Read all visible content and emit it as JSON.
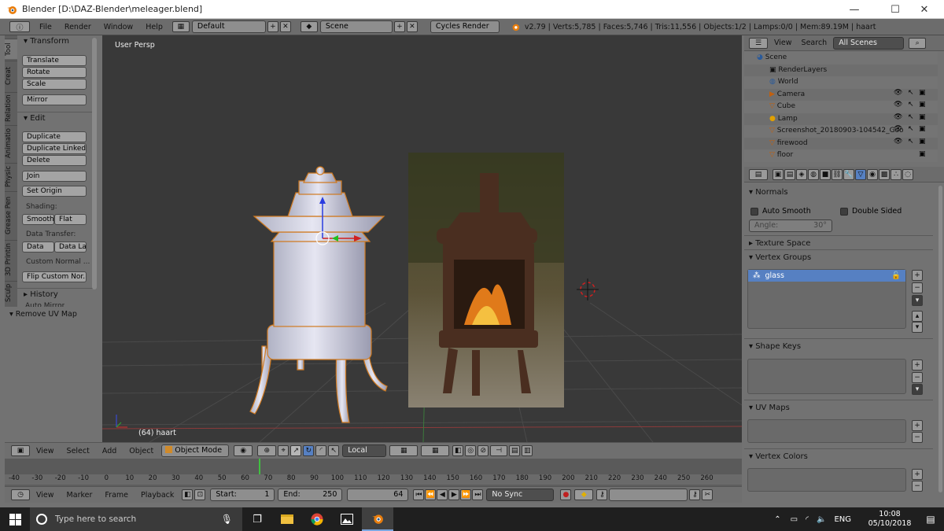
{
  "window": {
    "title": "Blender [D:\\DAZ-Blender\\meleager.blend]",
    "minimize": "—",
    "maximize": "☐",
    "close": "✕"
  },
  "info_header": {
    "menus": [
      "File",
      "Render",
      "Window",
      "Help"
    ],
    "layout": "Default",
    "scene": "Scene",
    "engine": "Cycles Render",
    "stats": "v2.79 | Verts:5,785 | Faces:5,746 | Tris:11,556 | Objects:1/2 | Lamps:0/0 | Mem:89.19M | haart"
  },
  "toolshelf": {
    "tabs": [
      "Tool",
      "Creat",
      "Relation",
      "Animatio",
      "Physic",
      "Grease Pen",
      "3D Printin",
      "Sculp"
    ],
    "transform_title": "Transform",
    "translate": "Translate",
    "rotate": "Rotate",
    "scale": "Scale",
    "mirror": "Mirror",
    "edit_title": "Edit",
    "duplicate": "Duplicate",
    "duplicate_linked": "Duplicate Linked",
    "delete": "Delete",
    "join": "Join",
    "set_origin": "Set Origin",
    "shading_label": "Shading:",
    "smooth": "Smooth",
    "flat": "Flat",
    "data_transfer_label": "Data Transfer:",
    "data": "Data",
    "data_la": "Data La",
    "custom_normal": "Custom Normal ...",
    "flip_custom": "Flip Custom Nor...",
    "history_title": "History",
    "auto_mirror": "Auto Mirror",
    "remove_uv": "Remove UV Map"
  },
  "viewport": {
    "view_label": "User Persp",
    "object_label": "(64) haart"
  },
  "view3d_header": {
    "menus": [
      "View",
      "Select",
      "Add",
      "Object"
    ],
    "mode": "Object Mode",
    "pivot": "Local"
  },
  "timeline": {
    "ticks": [
      "-40",
      "-30",
      "-20",
      "-10",
      "0",
      "10",
      "20",
      "30",
      "40",
      "50",
      "60",
      "70",
      "80",
      "90",
      "100",
      "110",
      "120",
      "130",
      "140",
      "150",
      "160",
      "170",
      "180",
      "190",
      "200",
      "210",
      "220",
      "230",
      "240",
      "250",
      "260"
    ],
    "menus": [
      "View",
      "Marker",
      "Frame",
      "Playback"
    ],
    "start_label": "Start:",
    "start_value": "1",
    "end_label": "End:",
    "end_value": "250",
    "current_frame": "64",
    "sync": "No Sync"
  },
  "outliner": {
    "menus": [
      "View",
      "Search"
    ],
    "filter": "All Scenes",
    "items": [
      {
        "name": "Scene",
        "indent": 0
      },
      {
        "name": "RenderLayers",
        "indent": 1
      },
      {
        "name": "World",
        "indent": 1
      },
      {
        "name": "Camera",
        "indent": 1
      },
      {
        "name": "Cube",
        "indent": 1
      },
      {
        "name": "Lamp",
        "indent": 1
      },
      {
        "name": "Screenshot_20180903-104542_Goo",
        "indent": 1
      },
      {
        "name": "firewood",
        "indent": 1
      },
      {
        "name": "floor",
        "indent": 1
      }
    ]
  },
  "properties": {
    "normals": "Normals",
    "auto_smooth": "Auto Smooth",
    "double_sided": "Double Sided",
    "angle_label": "Angle:",
    "angle_value": "30°",
    "texture_space": "Texture Space",
    "vertex_groups": "Vertex Groups",
    "vg_item": "glass",
    "shape_keys": "Shape Keys",
    "uv_maps": "UV Maps",
    "vertex_colors": "Vertex Colors"
  },
  "taskbar": {
    "search_placeholder": "Type here to search",
    "lang": "ENG",
    "time": "10:08",
    "date": "05/10/2018"
  },
  "colors": {
    "blender_bg": "#727272",
    "viewport": "#393939",
    "selected": "#5680c2",
    "taskbar": "#1f1f1f"
  }
}
